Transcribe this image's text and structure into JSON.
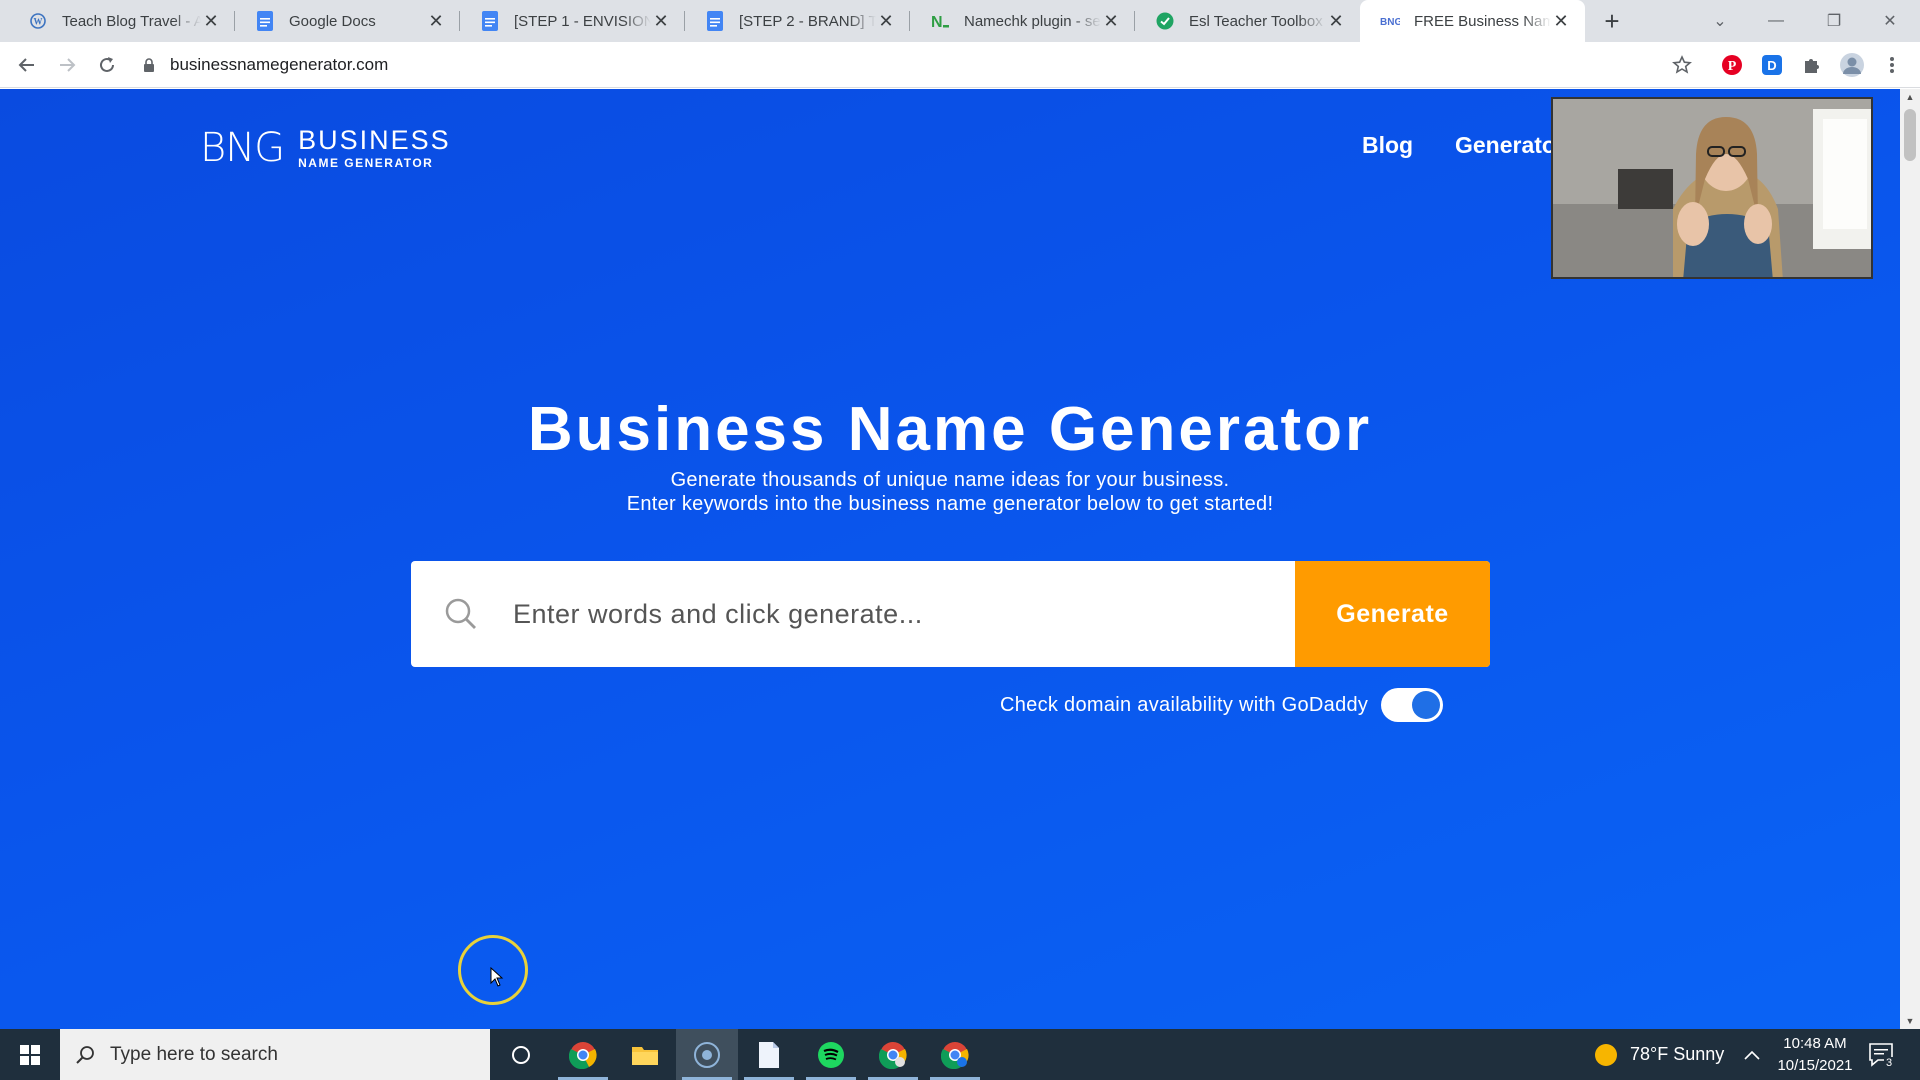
{
  "browser": {
    "tabs": [
      {
        "title": "Teach Blog Travel - Ac",
        "icon": "wordpress-icon",
        "active": false
      },
      {
        "title": "Google Docs",
        "icon": "google-docs-icon",
        "active": false
      },
      {
        "title": "[STEP 1 - ENVISION] T",
        "icon": "google-docs-icon",
        "active": false
      },
      {
        "title": "[STEP 2 - BRAND] TpT",
        "icon": "google-docs-icon",
        "active": false
      },
      {
        "title": "Namechk plugin - sea",
        "icon": "namechk-icon",
        "active": false
      },
      {
        "title": "Esl Teacher Toolbox W",
        "icon": "shield-check-icon",
        "active": false
      },
      {
        "title": "FREE Business Name G",
        "icon": "bng-icon",
        "active": true
      }
    ],
    "address": "businessnamegenerator.com",
    "colors": {
      "pinterest": "#e60023",
      "extension_d": "#1a73e8"
    }
  },
  "site": {
    "logo_mark": "BNG",
    "logo_word1": "BUSINESS",
    "logo_word2": "NAME GENERATOR",
    "nav": {
      "blog": "Blog",
      "generators": "Generato"
    },
    "title": "Business Name Generator",
    "subtitle1": "Generate thousands of unique name ideas for your business.",
    "subtitle2": "Enter keywords into the business name generator below to get started!",
    "search_placeholder": "Enter words and click generate...",
    "generate_label": "Generate",
    "domain_check_label": "Check domain availability with GoDaddy",
    "domain_check_enabled": true,
    "colors": {
      "background": "#0a55ec",
      "button": "#ff9b00"
    }
  },
  "taskbar": {
    "search_placeholder": "Type here to search",
    "weather": "78°F  Sunny",
    "time": "10:48 AM",
    "date": "10/15/2021",
    "notification_count": "3"
  }
}
